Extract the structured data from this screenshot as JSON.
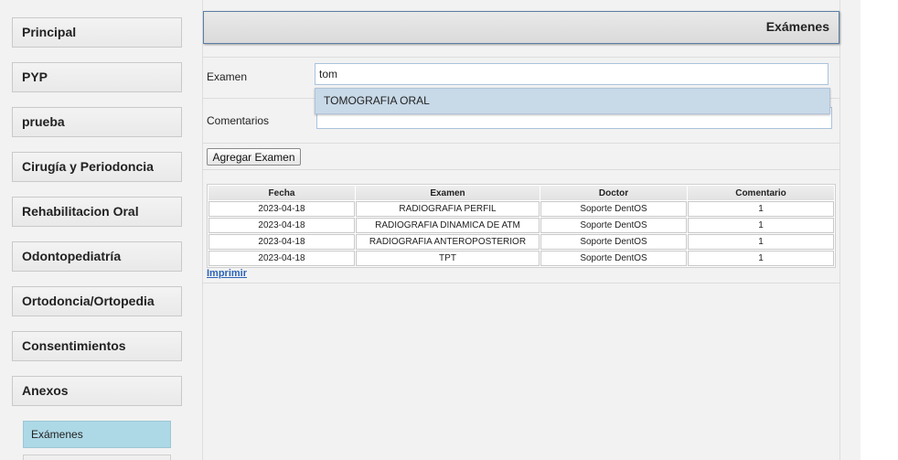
{
  "sidebar": {
    "items": [
      {
        "label": "Principal"
      },
      {
        "label": "PYP"
      },
      {
        "label": "prueba"
      },
      {
        "label": "Cirugía y Periodoncia"
      },
      {
        "label": "Rehabilitacion Oral"
      },
      {
        "label": "Odontopediatría"
      },
      {
        "label": "Ortodoncia/Ortopedia"
      },
      {
        "label": "Consentimientos"
      },
      {
        "label": "Anexos"
      }
    ],
    "sub_items": [
      {
        "label": "Exámenes",
        "active": true
      }
    ]
  },
  "header": {
    "title": "Exámenes"
  },
  "form": {
    "examen_label": "Examen",
    "examen_value": "tom",
    "autocomplete_option": "TOMOGRAFIA ORAL",
    "comentarios_label": "Comentarios",
    "comentarios_value": "",
    "add_button_label": "Agregar Examen"
  },
  "table": {
    "columns": [
      "Fecha",
      "Examen",
      "Doctor",
      "Comentario"
    ],
    "rows": [
      [
        "2023-04-18",
        "RADIOGRAFIA PERFIL",
        "Soporte DentOS",
        "1"
      ],
      [
        "2023-04-18",
        "RADIOGRAFIA DINAMICA DE ATM",
        "Soporte DentOS",
        "1"
      ],
      [
        "2023-04-18",
        "RADIOGRAFIA ANTEROPOSTERIOR",
        "Soporte DentOS",
        "1"
      ],
      [
        "2023-04-18",
        "TPT",
        "Soporte DentOS",
        "1"
      ]
    ]
  },
  "print_link": "Imprimir",
  "colors": {
    "active_sub_item": "#add8e6",
    "header_border": "#5b7fa4",
    "link": "#2a63b8"
  }
}
